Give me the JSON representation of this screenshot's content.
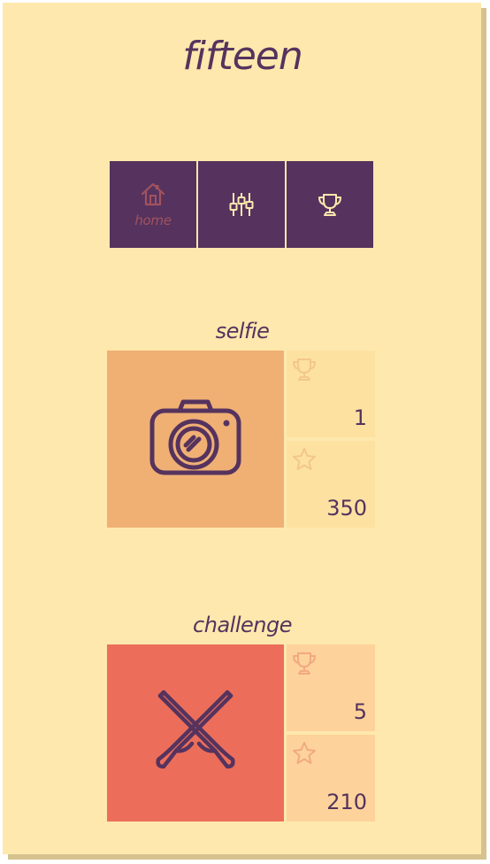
{
  "app": {
    "title": "fifteen"
  },
  "nav": {
    "home_label": "home",
    "items": [
      {
        "id": "home",
        "icon": "home-icon",
        "active": true
      },
      {
        "id": "settings",
        "icon": "sliders-icon",
        "active": false
      },
      {
        "id": "trophies",
        "icon": "trophy-icon",
        "active": false
      }
    ]
  },
  "modes": [
    {
      "title": "selfie",
      "icon": "camera-icon",
      "color": "#f0b074",
      "stat_color": "#fde1a1",
      "trophies": "1",
      "stars": "350"
    },
    {
      "title": "challenge",
      "icon": "crossed-swords-icon",
      "color": "#ec6e5a",
      "stat_color": "#fdd39b",
      "trophies": "5",
      "stars": "210"
    }
  ],
  "colors": {
    "background": "#fee8ad",
    "shadow": "#d6c28f",
    "primary": "#55335e",
    "accent_home_label": "#a2525e"
  }
}
